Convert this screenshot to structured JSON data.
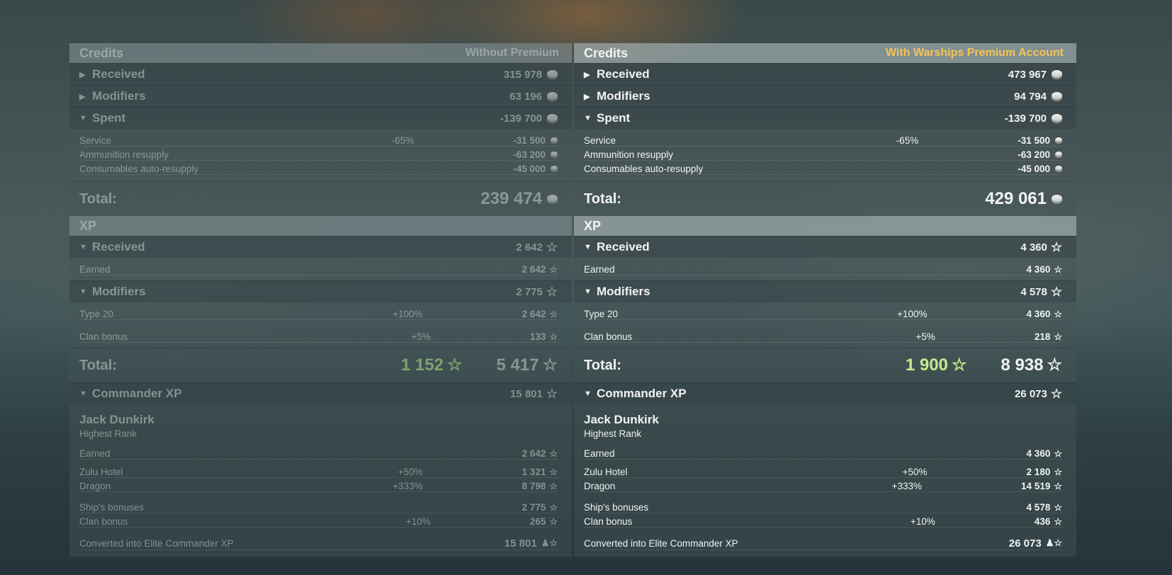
{
  "left": {
    "credits_title": "Credits",
    "mode": "Without Premium",
    "received": {
      "label": "Received",
      "value": "315 978"
    },
    "modifiers": {
      "label": "Modifiers",
      "value": "63 196"
    },
    "spent": {
      "label": "Spent",
      "value": "-139 700"
    },
    "spent_items": [
      {
        "label": "Service",
        "pct": "-65%",
        "value": "-31 500"
      },
      {
        "label": "Ammunition resupply",
        "pct": "",
        "value": "-63 200"
      },
      {
        "label": "Consumables auto-resupply",
        "pct": "",
        "value": "-45 000"
      }
    ],
    "credits_total": {
      "label": "Total:",
      "value": "239 474"
    },
    "xp_title": "XP",
    "xp_received": {
      "label": "Received",
      "value": "2 642"
    },
    "xp_earned": {
      "label": "Earned",
      "value": "2 642"
    },
    "xp_modifiers": {
      "label": "Modifiers",
      "value": "2 775"
    },
    "xp_mod_items": [
      {
        "label": "Type 20",
        "pct": "+100%",
        "value": "2 642"
      },
      {
        "label": "Clan bonus",
        "pct": "+5%",
        "value": "133"
      }
    ],
    "xp_total": {
      "label": "Total:",
      "bonus": "1 152",
      "value": "5 417"
    },
    "cmd": {
      "label": "Commander XP",
      "value": "15 801",
      "name": "Jack Dunkirk",
      "rank": "Highest Rank"
    },
    "cmd_items1": [
      {
        "label": "Earned",
        "pct": "",
        "value": "2 642"
      }
    ],
    "cmd_items2": [
      {
        "label": "Zulu Hotel",
        "pct": "+50%",
        "value": "1 321"
      },
      {
        "label": "Dragon",
        "pct": "+333%",
        "value": "8 798"
      }
    ],
    "cmd_items3": [
      {
        "label": "Ship's bonuses",
        "pct": "",
        "value": "2 775"
      },
      {
        "label": "Clan bonus",
        "pct": "+10%",
        "value": "265"
      }
    ],
    "converted": {
      "label": "Converted into Elite Commander XP",
      "value": "15 801"
    }
  },
  "right": {
    "credits_title": "Credits",
    "mode": "With Warships Premium Account",
    "received": {
      "label": "Received",
      "value": "473 967"
    },
    "modifiers": {
      "label": "Modifiers",
      "value": "94 794"
    },
    "spent": {
      "label": "Spent",
      "value": "-139 700"
    },
    "spent_items": [
      {
        "label": "Service",
        "pct": "-65%",
        "value": "-31 500"
      },
      {
        "label": "Ammunition resupply",
        "pct": "",
        "value": "-63 200"
      },
      {
        "label": "Consumables auto-resupply",
        "pct": "",
        "value": "-45 000"
      }
    ],
    "credits_total": {
      "label": "Total:",
      "value": "429 061"
    },
    "xp_title": "XP",
    "xp_received": {
      "label": "Received",
      "value": "4 360"
    },
    "xp_earned": {
      "label": "Earned",
      "value": "4 360"
    },
    "xp_modifiers": {
      "label": "Modifiers",
      "value": "4 578"
    },
    "xp_mod_items": [
      {
        "label": "Type 20",
        "pct": "+100%",
        "value": "4 360"
      },
      {
        "label": "Clan bonus",
        "pct": "+5%",
        "value": "218"
      }
    ],
    "xp_total": {
      "label": "Total:",
      "bonus": "1 900",
      "value": "8 938"
    },
    "cmd": {
      "label": "Commander XP",
      "value": "26 073",
      "name": "Jack Dunkirk",
      "rank": "Highest Rank"
    },
    "cmd_items1": [
      {
        "label": "Earned",
        "pct": "",
        "value": "4 360"
      }
    ],
    "cmd_items2": [
      {
        "label": "Zulu Hotel",
        "pct": "+50%",
        "value": "2 180"
      },
      {
        "label": "Dragon",
        "pct": "+333%",
        "value": "14 519"
      }
    ],
    "cmd_items3": [
      {
        "label": "Ship's bonuses",
        "pct": "",
        "value": "4 578"
      },
      {
        "label": "Clan bonus",
        "pct": "+10%",
        "value": "436"
      }
    ],
    "converted": {
      "label": "Converted into Elite Commander XP",
      "value": "26 073"
    }
  },
  "icons": {
    "credits": "credits-coin-icon",
    "xp": "xp-star-icon",
    "elite": "elite-commander-icon",
    "expanded": "caret-down-icon",
    "collapsed": "caret-right-icon"
  },
  "colors": {
    "premium_label": "#f3c456",
    "bonus_xp": "#c7ec8f"
  }
}
